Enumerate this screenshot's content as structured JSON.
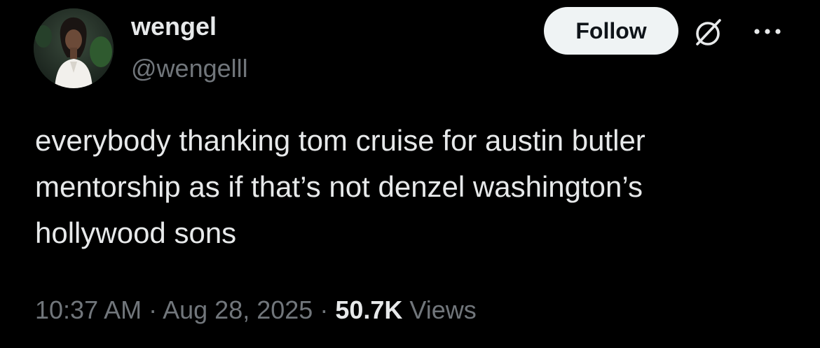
{
  "author": {
    "display_name": "wengel",
    "handle": "@wengelll"
  },
  "header": {
    "follow_label": "Follow",
    "icons": [
      "grok-icon",
      "more-icon"
    ]
  },
  "tweet": {
    "text_lines": [
      "everybody thanking tom cruise for austin butler",
      "mentorship as if that’s not denzel washington’s",
      "hollywood sons"
    ]
  },
  "meta": {
    "time": "10:37 AM",
    "separator": " · ",
    "date": "Aug 28, 2025",
    "views_count": "50.7K",
    "views_label": " Views"
  },
  "colors": {
    "background": "#000000",
    "primary_text": "#e7e9ea",
    "secondary_text": "#71767b",
    "button_bg": "#eff3f4"
  }
}
